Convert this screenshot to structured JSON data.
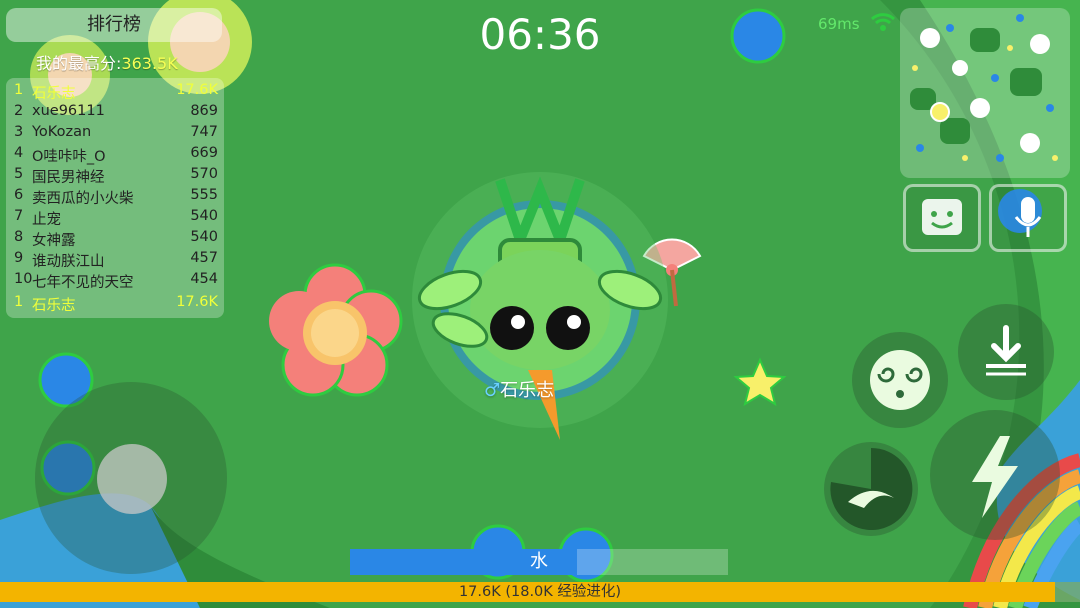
{
  "leaderboard": {
    "title": "排行榜",
    "best_label": "我的最高分:",
    "best_value": "363.5K",
    "rows": [
      {
        "rank": "1",
        "name": "石乐志",
        "score": "17.6K"
      },
      {
        "rank": "2",
        "name": "xue96111",
        "score": "869"
      },
      {
        "rank": "3",
        "name": "YoKozan",
        "score": "747"
      },
      {
        "rank": "4",
        "name": "O哇咔咔_O",
        "score": "669"
      },
      {
        "rank": "5",
        "name": "国民男神经",
        "score": "570"
      },
      {
        "rank": "6",
        "name": "卖西瓜的小火柴",
        "score": "555"
      },
      {
        "rank": "7",
        "name": "止宠",
        "score": "540"
      },
      {
        "rank": "8",
        "name": "女神露",
        "score": "540"
      },
      {
        "rank": "9",
        "name": "谁动朕江山",
        "score": "457"
      },
      {
        "rank": "10",
        "name": "七年不见的天空",
        "score": "454"
      }
    ],
    "self": {
      "rank": "1",
      "name": "石乐志",
      "score": "17.6K"
    }
  },
  "hud": {
    "timer": "06:36",
    "ping": "69ms",
    "player_name": "石乐志",
    "gender_symbol": "♂"
  },
  "water": {
    "label": "水",
    "level": 0.6
  },
  "xp": {
    "text": "17.6K (18.0K 经验进化)",
    "progress": 0.977
  },
  "buttons": {
    "emote": "emote-icon",
    "voice": "microphone-icon",
    "dive": "dive-down-icon",
    "dizzy": "dizzy-face-icon",
    "boost": "lightning-icon",
    "skill": "swoop-skill-icon"
  },
  "colors": {
    "accent_yellow": "#f0ff3a",
    "water_blue": "#2a87e6",
    "xp_gold": "#f3b400",
    "field_green": "#3fa44a"
  }
}
